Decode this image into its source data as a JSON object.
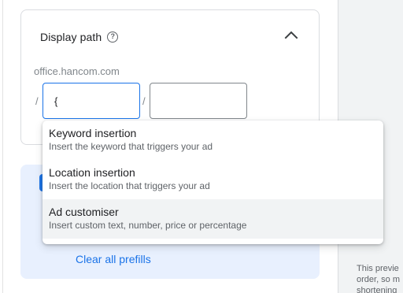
{
  "display_path": {
    "title": "Display path",
    "help_icon": "help-circle-icon",
    "collapse_icon": "chevron-up-icon",
    "domain": "office.hancom.com",
    "separator": "/",
    "path1_value": "{",
    "path2_value": ""
  },
  "dropdown": {
    "items": [
      {
        "title": "Keyword insertion",
        "description": "Insert the keyword that triggers your ad"
      },
      {
        "title": "Location insertion",
        "description": "Insert the location that triggers your ad"
      },
      {
        "title": "Ad customiser",
        "description": "Insert custom text, number, price or percentage"
      }
    ]
  },
  "prefills": {
    "clear_label": "Clear all prefills"
  },
  "side_note": {
    "line1": "This previe",
    "line2": "order, so m",
    "line3": "shortening"
  },
  "colors": {
    "accent": "#1a73e8",
    "highlight": "#e8f0fe"
  }
}
